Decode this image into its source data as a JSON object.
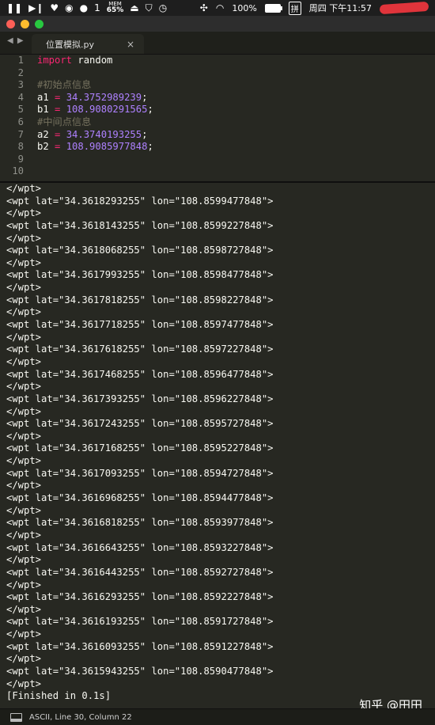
{
  "menubar": {
    "left_icons": [
      "pause-icon",
      "play-next-icon",
      "heart-icon",
      "weibo-icon",
      "wechat-icon"
    ],
    "wechat_badge": "1",
    "mem_label": "MEM",
    "mem_value": "65%",
    "right_icons": [
      "screen-icon",
      "shield-icon",
      "clock-icon",
      "network-icon",
      "wifi-icon"
    ],
    "battery_percent": "100%",
    "battery_level": 1.0,
    "input_method": "拼",
    "datetime": "周四 下午11:57"
  },
  "tab": {
    "title": "位置模拟.py",
    "close": "×"
  },
  "editor": {
    "line_numbers": [
      "1",
      "2",
      "3",
      "4",
      "5",
      "6",
      "7",
      "8",
      "9",
      "10"
    ],
    "import_kw": "import",
    "import_mod": " random",
    "comment1": "#初始点信息",
    "a1_name": "a1 ",
    "eq": "=",
    "a1_val": "34.3752989239",
    "b1_name": "b1 ",
    "b1_val": "108.9080291565",
    "semi": ";",
    "comment2": "#中间点信息",
    "a2_name": "a2 ",
    "a2_val": "34.3740193255",
    "b2_name": "b2 ",
    "b2_val": "108.9085977848"
  },
  "output": {
    "lines": [
      "</wpt>",
      "<wpt lat=\"34.3618293255\" lon=\"108.8599477848\">",
      "</wpt>",
      "<wpt lat=\"34.3618143255\" lon=\"108.8599227848\">",
      "</wpt>",
      "<wpt lat=\"34.3618068255\" lon=\"108.8598727848\">",
      "</wpt>",
      "<wpt lat=\"34.3617993255\" lon=\"108.8598477848\">",
      "</wpt>",
      "<wpt lat=\"34.3617818255\" lon=\"108.8598227848\">",
      "</wpt>",
      "<wpt lat=\"34.3617718255\" lon=\"108.8597477848\">",
      "</wpt>",
      "<wpt lat=\"34.3617618255\" lon=\"108.8597227848\">",
      "</wpt>",
      "<wpt lat=\"34.3617468255\" lon=\"108.8596477848\">",
      "</wpt>",
      "<wpt lat=\"34.3617393255\" lon=\"108.8596227848\">",
      "</wpt>",
      "<wpt lat=\"34.3617243255\" lon=\"108.8595727848\">",
      "</wpt>",
      "<wpt lat=\"34.3617168255\" lon=\"108.8595227848\">",
      "</wpt>",
      "<wpt lat=\"34.3617093255\" lon=\"108.8594727848\">",
      "</wpt>",
      "<wpt lat=\"34.3616968255\" lon=\"108.8594477848\">",
      "</wpt>",
      "<wpt lat=\"34.3616818255\" lon=\"108.8593977848\">",
      "</wpt>",
      "<wpt lat=\"34.3616643255\" lon=\"108.8593227848\">",
      "</wpt>",
      "<wpt lat=\"34.3616443255\" lon=\"108.8592727848\">",
      "</wpt>",
      "<wpt lat=\"34.3616293255\" lon=\"108.8592227848\">",
      "</wpt>",
      "<wpt lat=\"34.3616193255\" lon=\"108.8591727848\">",
      "</wpt>",
      "<wpt lat=\"34.3616093255\" lon=\"108.8591227848\">",
      "</wpt>",
      "<wpt lat=\"34.3615943255\" lon=\"108.8590477848\">",
      "</wpt>",
      "[Finished in 0.1s]"
    ]
  },
  "watermark": "知乎 @田田",
  "statusbar": {
    "text": "ASCII, Line 30, Column 22"
  }
}
